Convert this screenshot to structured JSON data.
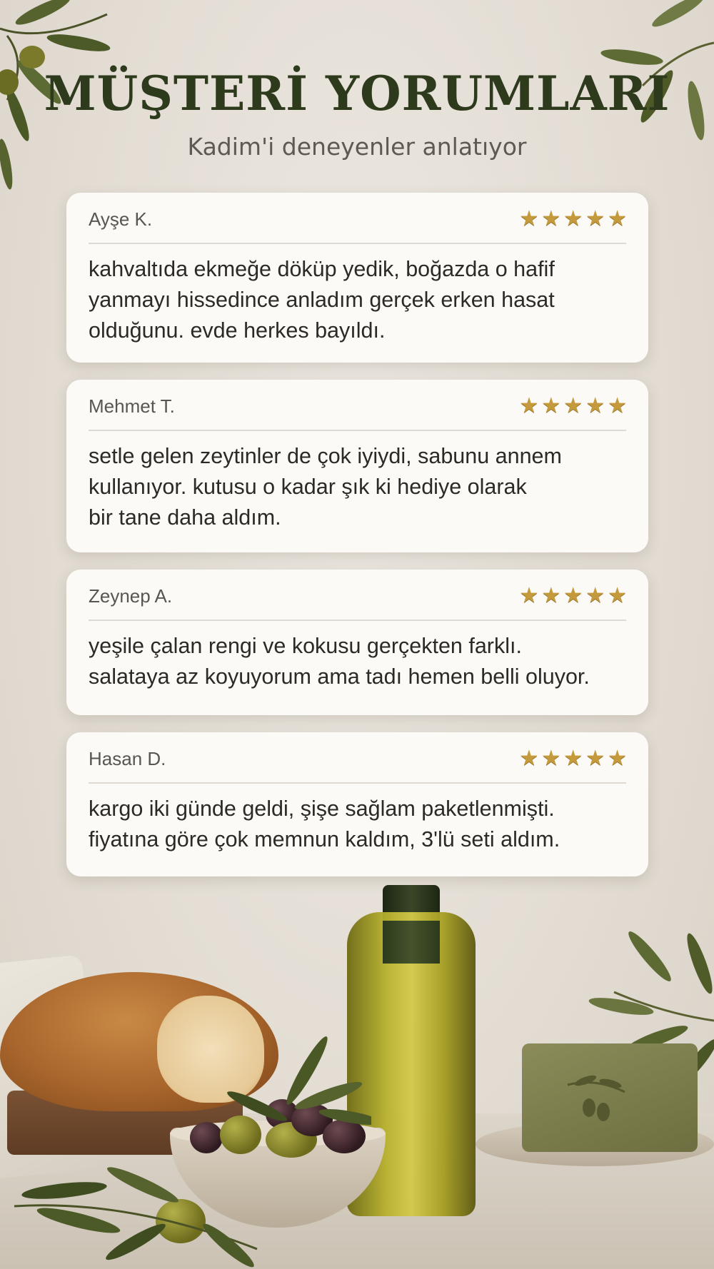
{
  "header": {
    "title": "MÜŞTERİ YORUMLARI",
    "subtitle": "Kadim'i deneyenler anlatıyor"
  },
  "reviews": [
    {
      "name": "Ayşe K.",
      "rating": 5,
      "text": "kahvaltıda ekmeğe döküp yedik, boğazda o hafif\nyanmayı hissedince anladım gerçek erken hasat\nolduğunu. evde herkes bayıldı."
    },
    {
      "name": "Mehmet T.",
      "rating": 5,
      "text": "setle gelen zeytinler de çok iyiydi, sabunu annem\nkullanıyor. kutusu o kadar şık ki hediye olarak\nbir tane daha aldım."
    },
    {
      "name": "Zeynep A.",
      "rating": 5,
      "text": "yeşile çalan rengi ve kokusu gerçekten farklı.\nsalataya az koyuyorum ama tadı hemen belli oluyor."
    },
    {
      "name": "Hasan D.",
      "rating": 5,
      "text": "kargo iki günde geldi, şişe sağlam paketlenmişti.\nfiyatına göre çok memnun kaldım, 3'lü seti aldım."
    }
  ],
  "colors": {
    "title": "#2e3a1c",
    "star": "#c49a3d",
    "card": "#fcfbf8"
  },
  "icons": {
    "star": "star-icon",
    "decor": [
      "olive-branch-icon",
      "bread-image",
      "olive-bowl-image",
      "olive-oil-bottle-image",
      "olive-soap-image"
    ]
  }
}
